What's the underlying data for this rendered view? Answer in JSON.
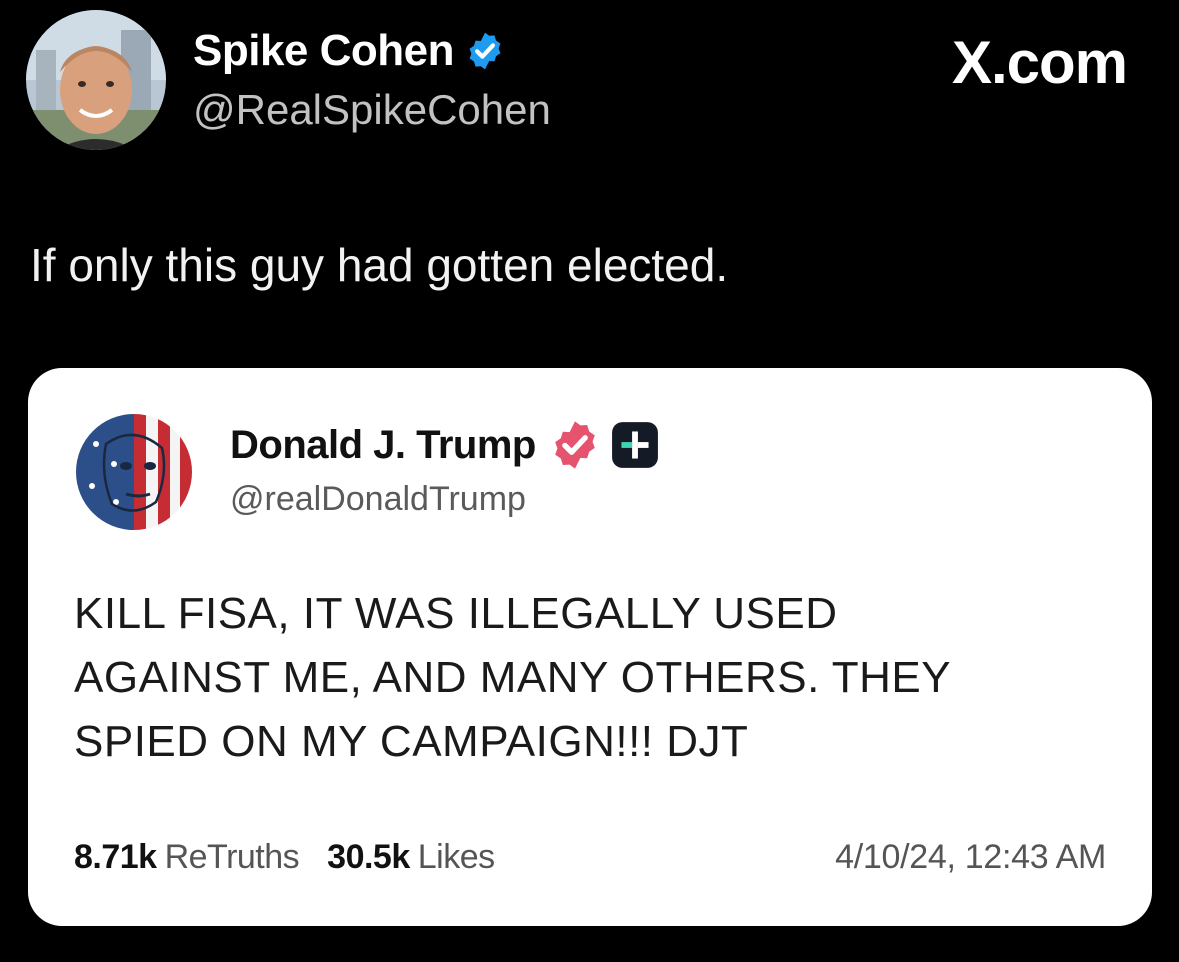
{
  "post": {
    "author_name": "Spike Cohen",
    "author_handle": "@RealSpikeCohen",
    "site_label": "X.com",
    "text": "If only this guy had gotten elected."
  },
  "quoted": {
    "author_name": "Donald J. Trump",
    "author_handle": "@realDonaldTrump",
    "body_lines": [
      "KILL FISA, IT WAS ILLEGALLY USED",
      "AGAINST ME, AND MANY OTHERS. THEY",
      "SPIED ON MY CAMPAIGN!!! DJT"
    ],
    "retruths_count": "8.71k",
    "retruths_label": "ReTruths",
    "likes_count": "30.5k",
    "likes_label": "Likes",
    "timestamp": "4/10/24, 12:43 AM"
  },
  "colors": {
    "background": "#000000",
    "verified_blue": "#1d9bf0",
    "truth_badge_pink": "#e5536f",
    "card_bg": "#ffffff"
  },
  "icons": {
    "verified": "verified-badge-icon",
    "truth_verified": "truth-verified-badge-icon",
    "truth_plus": "plus-badge-icon"
  }
}
